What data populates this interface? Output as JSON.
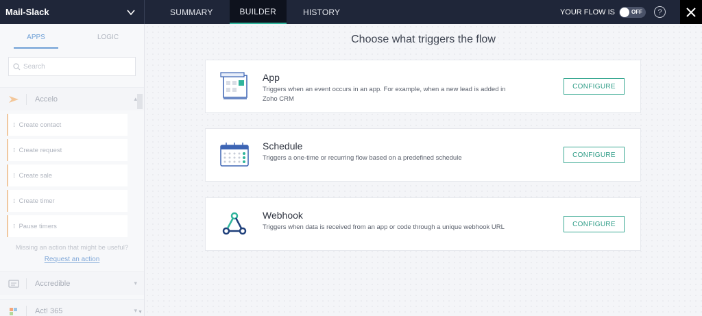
{
  "header": {
    "flow_name": "Mail-Slack",
    "tabs": [
      {
        "label": "SUMMARY",
        "active": false
      },
      {
        "label": "BUILDER",
        "active": true
      },
      {
        "label": "HISTORY",
        "active": false
      }
    ],
    "flow_status_label": "YOUR FLOW IS",
    "toggle_label": "OFF",
    "help_glyph": "?",
    "colors": {
      "bar": "#1f2639",
      "accent": "#2fb49c"
    }
  },
  "sidebar": {
    "tabs": [
      {
        "label": "APPS",
        "active": true
      },
      {
        "label": "LOGIC",
        "active": false
      }
    ],
    "search_placeholder": "Search",
    "apps": [
      {
        "name": "Accelo",
        "icon": "accelo-logo-icon",
        "expanded": true,
        "actions": [
          "Create contact",
          "Create request",
          "Create sale",
          "Create timer",
          "Pause timers"
        ]
      },
      {
        "name": "Accredible",
        "icon": "accredible-logo-icon",
        "expanded": false
      },
      {
        "name": "Act! 365",
        "icon": "act365-logo-icon",
        "expanded": false
      }
    ],
    "missing_text": "Missing an action that might be useful?",
    "request_link": "Request an action"
  },
  "main": {
    "title": "Choose what triggers the flow",
    "triggers": [
      {
        "title": "App",
        "icon": "app-window-icon",
        "description": "Triggers when an event occurs in an app. For example, when a new lead is added in Zoho CRM",
        "button": "CONFIGURE"
      },
      {
        "title": "Schedule",
        "icon": "calendar-icon",
        "description": "Triggers a one-time or recurring flow based on a predefined schedule",
        "button": "CONFIGURE"
      },
      {
        "title": "Webhook",
        "icon": "webhook-icon",
        "description": "Triggers when data is received from an app or code through a unique webhook URL",
        "button": "CONFIGURE"
      }
    ]
  }
}
